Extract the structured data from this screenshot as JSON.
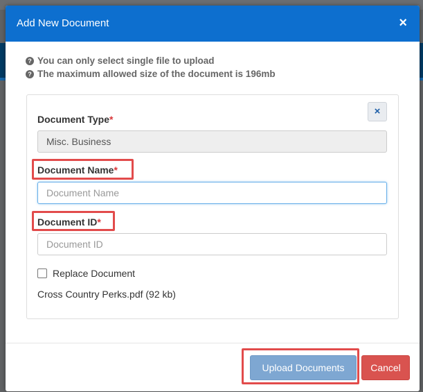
{
  "modal": {
    "title": "Add New Document",
    "close_symbol": "×"
  },
  "notes": [
    "You can only select single file to upload",
    "The maximum allowed size of the document is 196mb"
  ],
  "form": {
    "remove_symbol": "×",
    "document_type": {
      "label": "Document Type",
      "required_mark": "*",
      "value": "Misc. Business"
    },
    "document_name": {
      "label": "Document Name",
      "required_mark": "*",
      "placeholder": "Document Name",
      "value": ""
    },
    "document_id": {
      "label": "Document ID",
      "required_mark": "*",
      "placeholder": "Document ID",
      "value": ""
    },
    "replace_document": {
      "label": "Replace Document",
      "checked": false
    },
    "file_info": "Cross Country Perks.pdf (92 kb)"
  },
  "footer": {
    "upload_label": "Upload Documents",
    "cancel_label": "Cancel"
  },
  "colors": {
    "header": "#0d6fcf",
    "highlight": "#e24b4b",
    "upload": "#7ea7d2",
    "cancel": "#d9534f"
  },
  "icons": [
    "question-circle-icon",
    "close-icon",
    "remove-icon"
  ]
}
